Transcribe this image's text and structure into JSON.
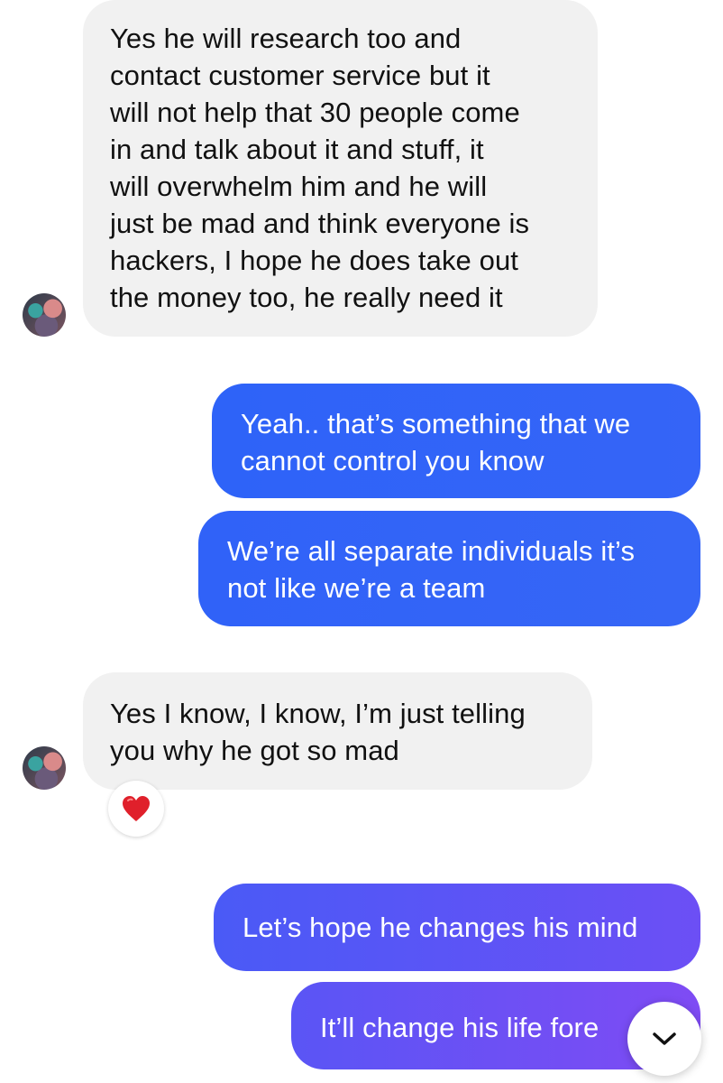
{
  "conversation": {
    "messages": [
      {
        "direction": "incoming",
        "text": "Yes he will research too and\ncontact customer service but it\nwill not help that 30 people come\nin and talk about it and stuff, it\nwill overwhelm him and he will\njust be mad and think everyone is\nhackers, I hope he does take out\nthe money too, he really need it"
      },
      {
        "direction": "outgoing",
        "text": "Yeah.. that’s something that we\ncannot control you know"
      },
      {
        "direction": "outgoing",
        "text": "We’re all separate individuals it’s\nnot like we’re a team"
      },
      {
        "direction": "incoming",
        "text": "Yes I know, I know, I’m just telling\nyou why he got so mad",
        "reaction": "❤️"
      },
      {
        "direction": "outgoing",
        "text": "Let’s hope he changes his mind"
      },
      {
        "direction": "outgoing",
        "text": "It’ll change his life fore"
      }
    ]
  },
  "colors": {
    "incoming_bubble": "#f1f1f1",
    "outgoing_blue": "#2f66f7",
    "outgoing_purple": "#7a4cf5",
    "heart": "#e0202b"
  },
  "icons": {
    "avatar": "contact-avatar",
    "reaction": "heart-reaction-icon",
    "scroll": "chevron-down-icon"
  }
}
